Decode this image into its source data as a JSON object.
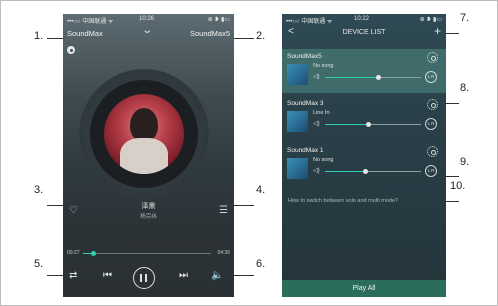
{
  "callouts": [
    "1.",
    "2.",
    "3.",
    "4.",
    "5.",
    "6.",
    "7.",
    "8.",
    "9.",
    "10."
  ],
  "player": {
    "status": {
      "carrier": "•••○○ 中国联通 ᯤ",
      "time": "10:26",
      "right": "⊕ ❥ ▮▭"
    },
    "left_device": "SoundMax",
    "right_device": "SoundMax5",
    "song_title": "泽熏",
    "artist": "杨宗纬",
    "time_elapsed": "00:27",
    "time_total": "04:36",
    "progress": 0.08,
    "icons": [
      "settings-icon",
      "heart-icon",
      "playlist-icon",
      "repeat-icon",
      "prev-icon",
      "pause-icon",
      "next-icon",
      "volume-icon",
      "chevron-down-icon"
    ]
  },
  "device_list": {
    "status": {
      "carrier": "•••○○ 中国联通 ᯤ",
      "time": "10:22",
      "right": "⊕ ❥ ▮▭"
    },
    "title": "DEVICE LIST",
    "back": "<",
    "add": "+",
    "devices": [
      {
        "name": "SoundMax5",
        "song": "No song",
        "volume": 0.55,
        "lr": "L R",
        "active": true
      },
      {
        "name": "SoundMax 3",
        "song": "Line In",
        "volume": 0.45,
        "lr": "L R",
        "active": false
      },
      {
        "name": "SoundMax 1",
        "song": "No song",
        "volume": 0.42,
        "lr": "L R",
        "active": false
      }
    ],
    "help": "How to switch between solo and multi mode?",
    "play_all": "Play All"
  },
  "colors": {
    "accent": "#2fd0ad",
    "active_card": "#3f6b6a",
    "play_all_bar": "#2b6d5a"
  }
}
